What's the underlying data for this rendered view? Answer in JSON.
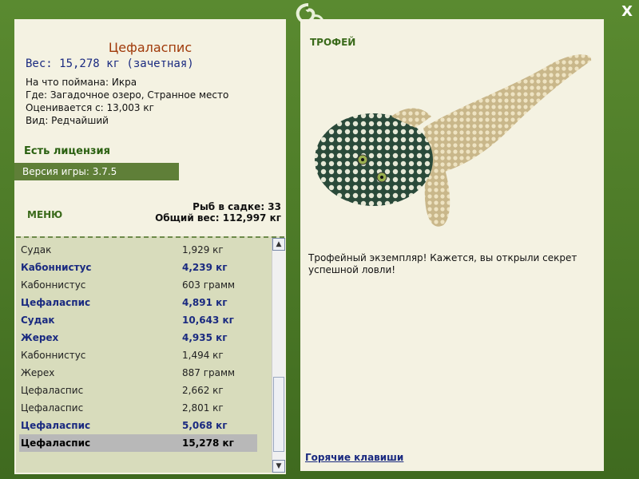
{
  "window": {
    "close_label": "X"
  },
  "fish": {
    "title": "Цефаласпис",
    "weight": "Вес: 15,278 кг (зачетная)",
    "caught_on": "На что поймана: Икра",
    "location": "Где: Загадочное озеро, Странное место",
    "rated_from": "Оценивается с: 13,003 кг",
    "species": "Вид: Редчайший"
  },
  "license": "Есть лицензия",
  "version": "Версия игры: 3.7.5",
  "menu_label": "МЕНЮ",
  "keepnet": {
    "count": "Рыб в садке: 33",
    "total": "Общий вес: 112,997 кг"
  },
  "catch_list": [
    {
      "name": "Судак",
      "weight": "1,929 кг",
      "style": "normal"
    },
    {
      "name": "Кабоннистус",
      "weight": "4,239 кг",
      "style": "bold"
    },
    {
      "name": "Кабоннистус",
      "weight": "603 грамм",
      "style": "normal"
    },
    {
      "name": "Цефаласпис",
      "weight": "4,891 кг",
      "style": "bold"
    },
    {
      "name": "Судак",
      "weight": "10,643 кг",
      "style": "bold"
    },
    {
      "name": "Жерех",
      "weight": "4,935 кг",
      "style": "bold"
    },
    {
      "name": "Кабоннистус",
      "weight": "1,494 кг",
      "style": "normal"
    },
    {
      "name": "Жерех",
      "weight": "887 грамм",
      "style": "normal"
    },
    {
      "name": "Цефаласпис",
      "weight": "2,662 кг",
      "style": "normal"
    },
    {
      "name": "Цефаласпис",
      "weight": "2,801 кг",
      "style": "normal"
    },
    {
      "name": "Цефаласпис",
      "weight": "5,068 кг",
      "style": "bold"
    },
    {
      "name": "Цефаласпис",
      "weight": "15,278 кг",
      "style": "selected"
    }
  ],
  "trophy_label": "ТРОФЕЙ",
  "trophy_text": "Трофейный экземпляр! Кажется, вы открыли секрет успешной ловли!",
  "hotkeys_label": "Горячие клавиши",
  "colors": {
    "frame": "#4f7a2a",
    "panel": "#f4f2e2",
    "accent_blue": "#1a2a80",
    "title_red": "#a03a0a"
  }
}
